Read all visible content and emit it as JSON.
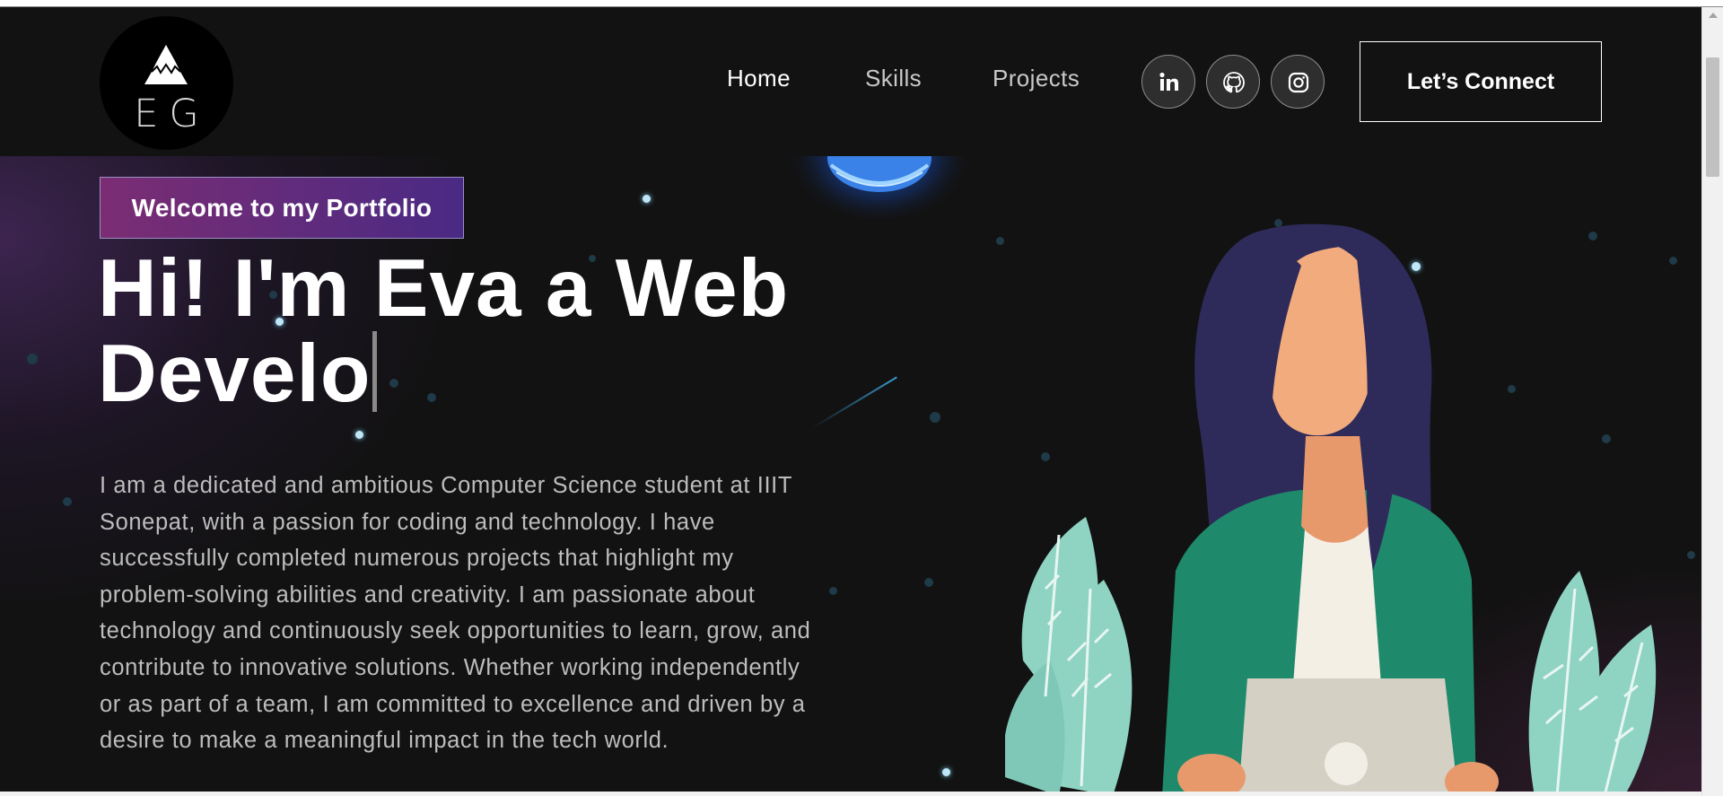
{
  "logo": {
    "letters": "EG"
  },
  "nav": {
    "links": [
      {
        "label": "Home",
        "active": true
      },
      {
        "label": "Skills",
        "active": false
      },
      {
        "label": "Projects",
        "active": false
      }
    ],
    "social_icons": [
      "linkedin-icon",
      "github-icon",
      "instagram-icon"
    ],
    "connect_label": "Let’s Connect"
  },
  "hero": {
    "tagline": "Welcome to my Portfolio",
    "headline_line1": "Hi! I'm Eva a Web",
    "headline_line2": "Develo",
    "bio_lines": [
      "I am a dedicated and ambitious Computer Science student at IIIT",
      "Sonepat, with a passion for coding and technology. I have",
      "successfully completed numerous projects that highlight my",
      "problem-solving abilities and creativity. I am passionate about",
      "technology and continuously seek opportunities to learn, grow, and",
      "contribute to innovative solutions. Whether working independently",
      "or as part of a team, I am committed to excellence and driven by a",
      "desire to make a meaningful impact in the tech world."
    ]
  },
  "colors": {
    "background": "#121212",
    "tagline_gradient_start": "#7b2d73",
    "tagline_gradient_end": "#4a2a84",
    "text_primary": "#ffffff",
    "text_secondary": "#bdbdbd",
    "jacket": "#1f8a6b",
    "hair": "#2e2b5a",
    "skin": "#f2ab7c",
    "leaves": "#8fd3c3"
  }
}
